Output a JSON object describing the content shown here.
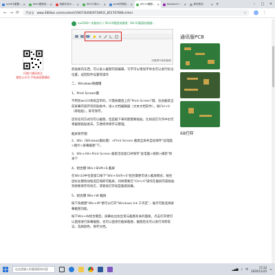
{
  "browser": {
    "tabs": [
      {
        "label": "word中重叠图案的...",
        "favicon_color": "#3a7bd5",
        "active": false
      },
      {
        "label": "Word里面怎么画...",
        "favicon_color": "#4caf50",
        "active": false
      },
      {
        "label": "电脑中怎么截图...",
        "favicon_color": "#e53935",
        "active": false
      },
      {
        "label": "Win10怎么截屏...",
        "favicon_color": "#4caf50",
        "active": false
      },
      {
        "label": "word的剪贴板...",
        "favicon_color": "#3a7bd5",
        "active": false
      },
      {
        "label": "Win10截图快捷键...",
        "favicon_color": "#4caf50",
        "active": true
      },
      {
        "label": "Notepad++ 显示...",
        "favicon_color": "#8e24aa",
        "active": false
      },
      {
        "label": "新标签页",
        "favicon_color": "#9e9e9e",
        "active": false
      }
    ],
    "new_tab": "+",
    "win_controls": [
      "–",
      "□",
      "✕"
    ],
    "nav": {
      "back": "←",
      "forward": "→",
      "reload": "⟳"
    },
    "address": {
      "secure_label": "不安全",
      "url": "www.360doc.com/content/19/0730/06/9718931_851767668.shtml"
    },
    "menu": "⋮"
  },
  "page": {
    "qr_caption": "扫描二维码关注\n微信公众号 手机阅读更精彩",
    "header_source": "xw2468 / 电脑技巧 / Win10截图快捷键：Win10截屏快捷键...",
    "shot_footer": "设置操作面板截图",
    "paragraphs": [
      {
        "id": "p1",
        "kind": "p",
        "text": "剪贴板的东西，可以进入截图内容编辑、写字可以增加字体也可以进行标注位置，返回软件设置等操作"
      },
      {
        "id": "h1",
        "kind": "h",
        "text": "二、Windows快捷键"
      },
      {
        "id": "h2",
        "kind": "h",
        "text": "1、Print Screen键"
      },
      {
        "id": "p2",
        "kind": "p",
        "text": "不用装win10系统自带的，只需按键盘上的\"Print Screen\"键，也会截取当前屏幕内容存到剪贴板中，进入文档编辑器（文本文档软件），按Ctrl+V（即粘贴），即可保存。"
      },
      {
        "id": "p3",
        "kind": "p",
        "text": "还有任何方式均可以截图，但是截下来的图需要粘贴，比如说在写作中也可将截图粘贴进去，方便修改保存与整理。"
      },
      {
        "id": "p4",
        "kind": "p",
        "text": "截屏保存键："
      },
      {
        "id": "p5",
        "kind": "p",
        "text": "2、Win（Windows徽标键）+Print Screen 截图全屏并自动保存\"此电脑>图片>屏幕截图\"下。"
      },
      {
        "id": "p6",
        "kind": "p",
        "text": "3、Win+Alt+Print Screen 截取活动窗口并保存\"此电脑>视频>捕获\"目录下"
      },
      {
        "id": "h3",
        "kind": "h",
        "text": "4、组合键 Win+Shift+S 截屏"
      },
      {
        "id": "p7",
        "kind": "p",
        "text": "在Win10中任意窗口按下\"Win+Shift+S\"组合键便可进入截屏模式，按住鼠标左键拖动框选区域即可截屏，同样需要在\"Ctrl+V\"操作在截屏内容粘贴到想要保存的地方，或者再打开就是截取屏幕。"
      },
      {
        "id": "h4",
        "kind": "h",
        "text": "5、组合键 Win+W 截屏"
      },
      {
        "id": "p8",
        "kind": "p",
        "text": "按下快捷键\"Win+W\"便可以打开\"Windows Ink 工作区\"，展示可能选择屏幕截图功能。"
      },
      {
        "id": "p9",
        "kind": "p",
        "text": "按下Win+W组合键后，屏幕右边会出现与截图有关的面板，点击打开便可以直接进行屏幕截图，也可以直接在截屏截图，截图后也可以进行涂鸦笔记、选择颜色、保存文档。"
      }
    ]
  },
  "ad": {
    "title": "通讯版PCB",
    "subtitle": "68打样"
  },
  "taskbar": {
    "search_placeholder": "在这里输入你要搜索的内容",
    "time": "17:22",
    "date": "2020/11/25",
    "lang": "中"
  }
}
